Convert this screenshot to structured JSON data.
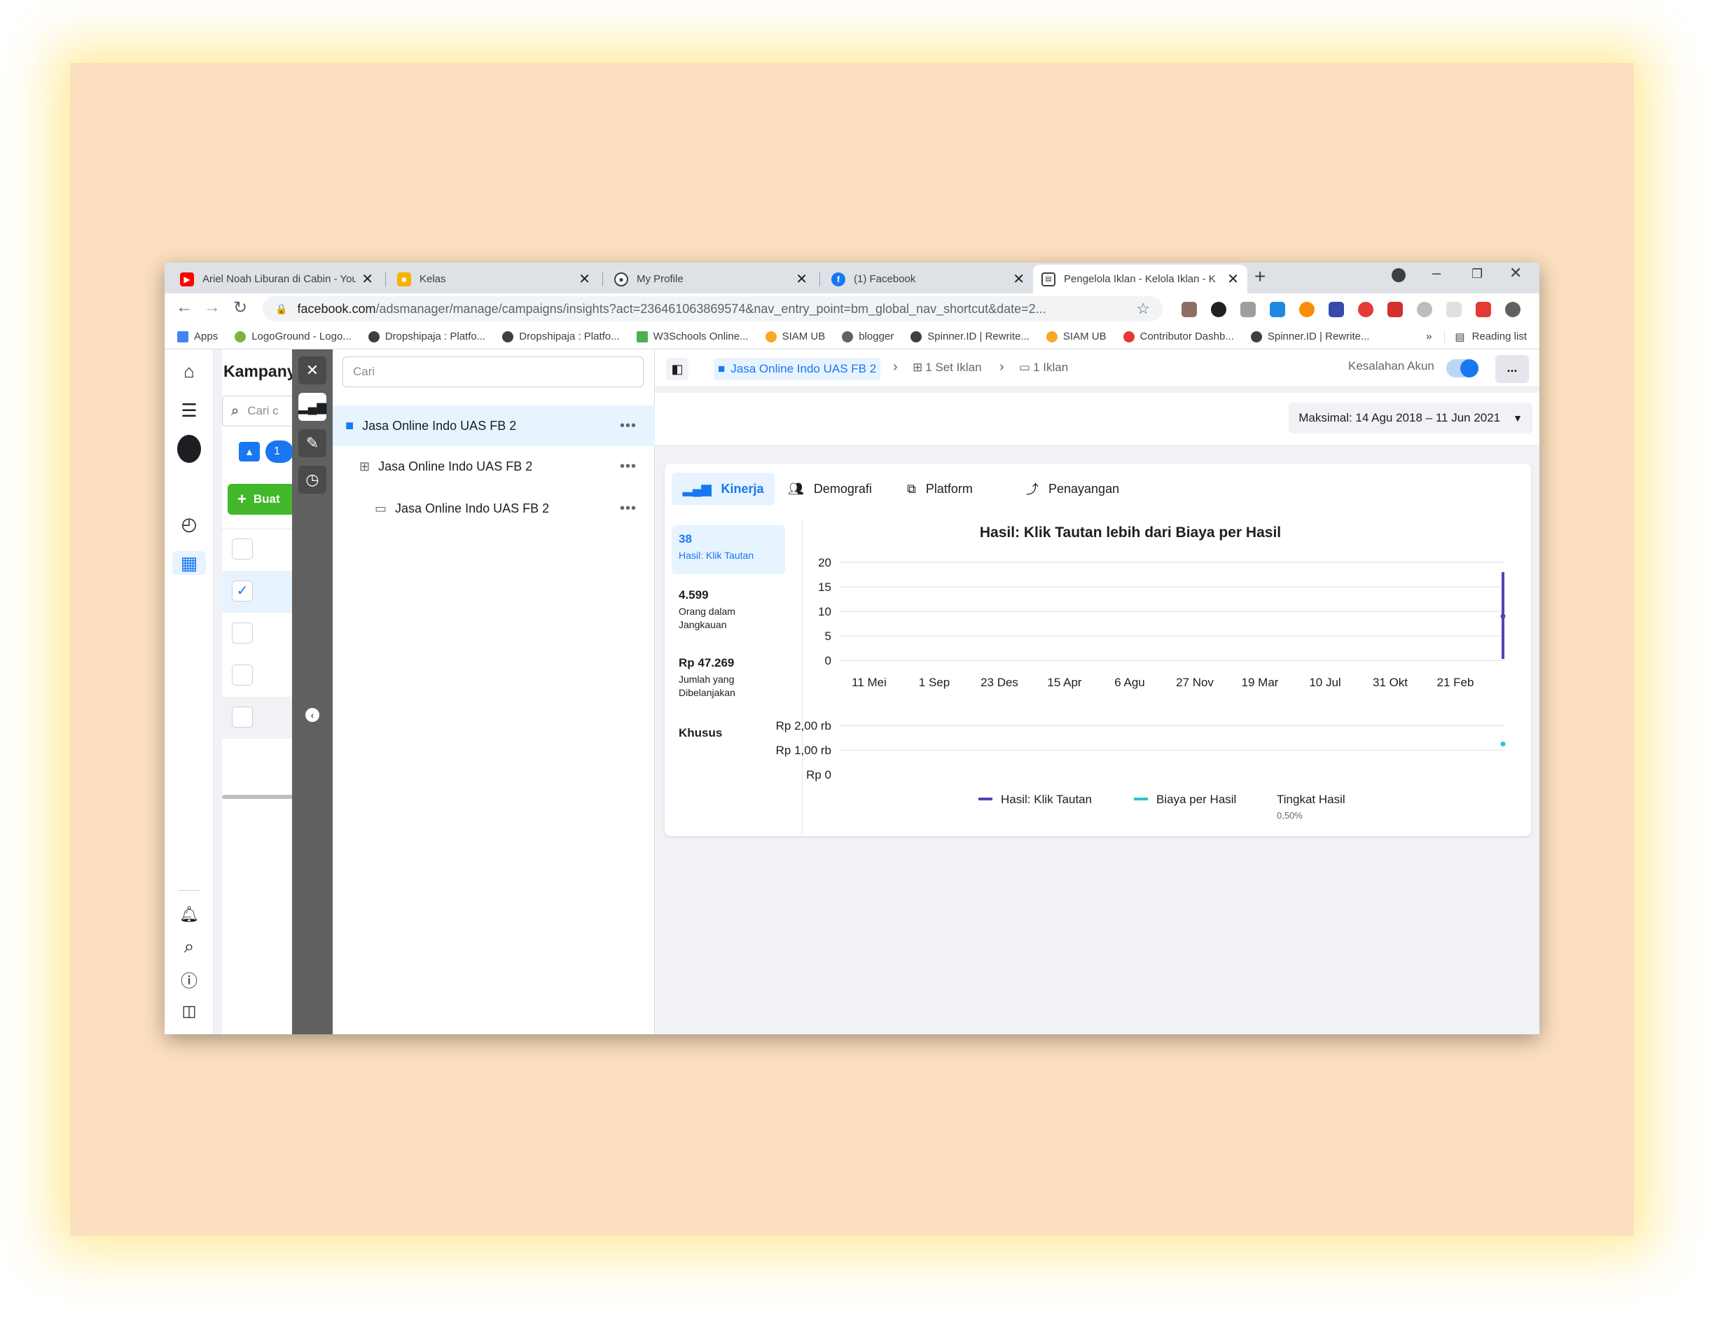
{
  "browser": {
    "tabs": [
      {
        "title": "Ariel Noah Liburan di Cabin - You",
        "icon": "youtube-icon",
        "color": "#ff0000"
      },
      {
        "title": "Kelas",
        "icon": "classroom-icon",
        "color": "#f4b400"
      },
      {
        "title": "My Profile",
        "icon": "profile-icon",
        "color": "#3c4043"
      },
      {
        "title": "(1) Facebook",
        "icon": "facebook-icon",
        "color": "#1877f2"
      },
      {
        "title": "Pengelola Iklan - Kelola Iklan - K",
        "icon": "ads-manager-icon",
        "color": "#3c4043"
      }
    ],
    "url_main": "facebook.com",
    "url_path": "/adsmanager/manage/campaigns/insights?act=236461063869574&nav_entry_point=bm_global_nav_shortcut&date=2...",
    "bookmarks": [
      {
        "label": "Apps",
        "color": "#4285f4"
      },
      {
        "label": "LogoGround - Logo...",
        "color": "#7cb342"
      },
      {
        "label": "Dropshipaja : Platfo...",
        "color": "#3c4043"
      },
      {
        "label": "Dropshipaja : Platfo...",
        "color": "#3c4043"
      },
      {
        "label": "W3Schools Online...",
        "color": "#4caf50"
      },
      {
        "label": "SIAM UB",
        "color": "#f9a825"
      },
      {
        "label": "blogger",
        "color": "#5f6368"
      },
      {
        "label": "Spinner.ID | Rewrite...",
        "color": "#3c4043"
      },
      {
        "label": "SIAM UB",
        "color": "#f9a825"
      },
      {
        "label": "Contributor Dashb...",
        "color": "#e53935"
      },
      {
        "label": "Spinner.ID | Rewrite...",
        "color": "#3c4043"
      }
    ],
    "more": "»",
    "reading_list": "Reading list"
  },
  "campaign_panel": {
    "title": "Kampany",
    "search": "Cari c",
    "count": "1",
    "create_label": "Buat"
  },
  "tree": {
    "search_placeholder": "Cari",
    "items": [
      {
        "label": "Jasa Online Indo UAS FB 2",
        "level": "Kampanye"
      },
      {
        "label": "Jasa Online Indo UAS FB 2",
        "level": "Set Iklan"
      },
      {
        "label": "Jasa Online Indo UAS FB 2",
        "level": "Iklan"
      }
    ],
    "more": "•••"
  },
  "breadcrumb": {
    "campaign": "Jasa Online Indo UAS FB 2",
    "adset": "1 Set Iklan",
    "ad": "1 Iklan"
  },
  "account_error_label": "Kesalahan Akun",
  "more_label": "...",
  "date_range": "Maksimal: 14 Agu 2018 – 11 Jun 2021",
  "insight_tabs": [
    "Kinerja",
    "Demografi",
    "Platform",
    "Penayangan"
  ],
  "metrics": [
    {
      "value": "38",
      "label": "Hasil: Klik Tautan"
    },
    {
      "value": "4.599",
      "label": "Orang dalam Jangkauan"
    },
    {
      "value": "Rp 47.269",
      "label": "Jumlah yang Dibelanjakan"
    },
    {
      "value": "Khusus",
      "label": ""
    }
  ],
  "chart_data": {
    "type": "line",
    "title": "Hasil: Klik Tautan lebih dari Biaya per Hasil",
    "x_ticks": [
      "11 Mei",
      "1 Sep",
      "23 Des",
      "15 Apr",
      "6 Agu",
      "27 Nov",
      "19 Mar",
      "10 Jul",
      "31 Okt",
      "21 Feb"
    ],
    "top_panel": {
      "ylim": [
        0,
        20
      ],
      "y_ticks": [
        "20",
        "15",
        "10",
        "5",
        "0"
      ]
    },
    "bottom_panel": {
      "ylim": [
        0,
        2000
      ],
      "y_ticks": [
        "Rp 2,00 rb",
        "Rp 1,00 rb",
        "Rp 0"
      ]
    },
    "series": [
      {
        "name": "Hasil: Klik Tautan",
        "color": "#5b3fb3",
        "last_value": 18,
        "marker_value": 9
      },
      {
        "name": "Biaya per Hasil",
        "color": "#2ec4cc",
        "last_value": 1244
      }
    ],
    "legend": [
      {
        "label": "Hasil: Klik Tautan",
        "color": "#5b3fb3"
      },
      {
        "label": "Biaya per Hasil",
        "color": "#2ec4cc"
      },
      {
        "label": "Tingkat Hasil",
        "sub": "0,50%"
      }
    ],
    "grid": true,
    "legend_position": "bottom"
  }
}
